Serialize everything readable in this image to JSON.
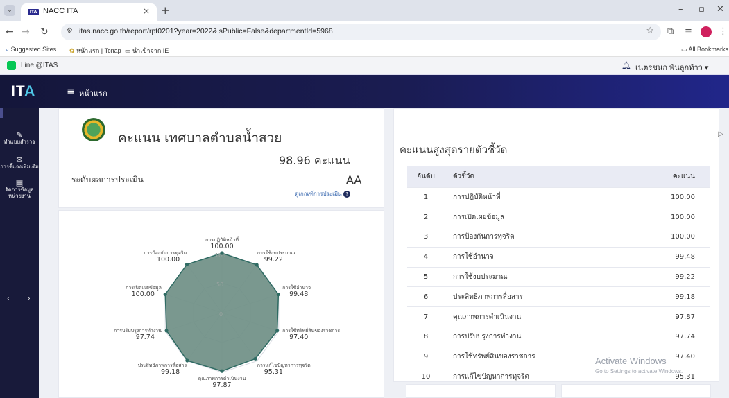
{
  "browser": {
    "tab_title": "NACC ITA",
    "tab_favicon": "ITA",
    "tab_close": "×",
    "new_tab": "+",
    "tab_menu": "⌄",
    "url": "itas.nacc.go.th/report/rpt0201?year=2022&isPublic=False&departmentId=5968",
    "window_controls": {
      "minimize": "–",
      "maximize": "▫",
      "close": "✕"
    },
    "nav": {
      "back": "←",
      "forward": "→",
      "reload": "↻"
    },
    "bookmarks": [
      {
        "icon": "search-icon",
        "label": "Suggested Sites"
      },
      {
        "icon": "tcnap-icon",
        "label": "หน้าแรก | Tcnap"
      },
      {
        "icon": "folder-icon",
        "label": "นำเข้าจาก IE"
      }
    ],
    "all_bookmarks": "All Bookmarks"
  },
  "infobar": {
    "line_label": "Line @ITAS",
    "user_name": "เนตรชนก พันลูกท้าว ▾"
  },
  "header": {
    "logo_main": "IT",
    "logo_accent": "A",
    "menu_icon": "≡",
    "page_title": "หน้าแรก"
  },
  "sidebar": {
    "items": [
      {
        "icon": "survey-icon",
        "glyph": "✎",
        "label": "ทำแบบสำรวจ"
      },
      {
        "icon": "mail-icon",
        "glyph": "✉",
        "label": "การชี้แจงเพิ่มเติม"
      },
      {
        "icon": "clipboard-icon",
        "glyph": "▤",
        "label_line1": "จัดการข้อมูล",
        "label_line2": "หน่วยงาน"
      }
    ],
    "pager_prev": "‹",
    "pager_next": "›"
  },
  "summary": {
    "title": "คะแนน เทศบาลตำบลน้ำสวย",
    "score": "98.96 คะแนน",
    "level_label": "ระดับผลการประเมิน",
    "level": "AA",
    "criteria_link": "ดูเกณฑ์การประเมิน"
  },
  "chart_data": {
    "type": "radar",
    "rmin": 0,
    "rmax": 100,
    "grid_labels": [
      "0",
      "50",
      "100"
    ],
    "axes": [
      {
        "label": "การปฏิบัติหน้าที่",
        "value": 100.0,
        "value_text": "100.00"
      },
      {
        "label": "การใช้งบประมาณ",
        "value": 99.22,
        "value_text": "99.22"
      },
      {
        "label": "การใช้อำนาจ",
        "value": 99.48,
        "value_text": "99.48"
      },
      {
        "label": "การใช้ทรัพย์สินของราชการ",
        "value": 97.4,
        "value_text": "97.40"
      },
      {
        "label": "การแก้ไขปัญหาการทุจริต",
        "value": 95.31,
        "value_text": "95.31"
      },
      {
        "label": "คุณภาพการดำเนินงาน",
        "value": 97.87,
        "value_text": "97.87"
      },
      {
        "label": "ประสิทธิภาพการสื่อสาร",
        "value": 99.18,
        "value_text": "99.18"
      },
      {
        "label": "การปรับปรุงการทำงาน",
        "value": 97.74,
        "value_text": "97.74"
      },
      {
        "label": "การเปิดเผยข้อมูล",
        "value": 100.0,
        "value_text": "100.00"
      },
      {
        "label": "การป้องกันการทุจริต",
        "value": 100.0,
        "value_text": "100.00"
      }
    ],
    "fill_color": "#6f8f86",
    "stroke_color": "#2f6b63"
  },
  "ranking": {
    "title": "คะแนนสูงสุดรายตัวชี้วัด",
    "columns": [
      "อันดับ",
      "ตัวชี้วัด",
      "คะแนน"
    ],
    "rows": [
      [
        "1",
        "การปฏิบัติหน้าที่",
        "100.00"
      ],
      [
        "2",
        "การเปิดเผยข้อมูล",
        "100.00"
      ],
      [
        "3",
        "การป้องกันการทุจริต",
        "100.00"
      ],
      [
        "4",
        "การใช้อำนาจ",
        "99.48"
      ],
      [
        "5",
        "การใช้งบประมาณ",
        "99.22"
      ],
      [
        "6",
        "ประสิทธิภาพการสื่อสาร",
        "99.18"
      ],
      [
        "7",
        "คุณภาพการดำเนินงาน",
        "97.87"
      ],
      [
        "8",
        "การปรับปรุงการทำงาน",
        "97.74"
      ],
      [
        "9",
        "การใช้ทรัพย์สินของราชการ",
        "97.40"
      ],
      [
        "10",
        "การแก้ไขปัญหาการทุจริต",
        "95.31"
      ]
    ]
  },
  "watermark": {
    "line1": "Activate Windows",
    "line2": "Go to Settings to activate Windows."
  }
}
